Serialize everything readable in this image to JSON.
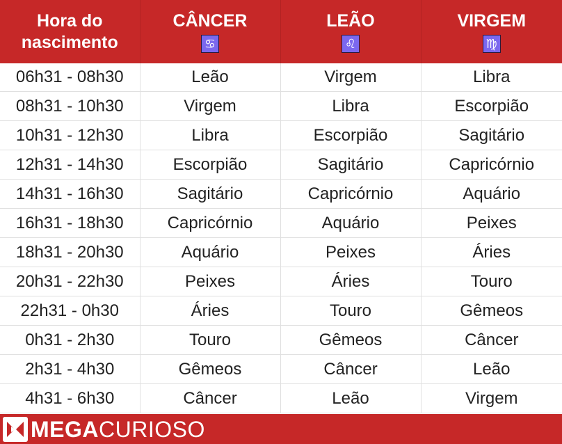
{
  "header": {
    "col0": "Hora do nascimento",
    "signs": [
      {
        "name": "CÂNCER",
        "icon": "cancer-icon",
        "glyph": "♋"
      },
      {
        "name": "LEÃO",
        "icon": "leo-icon",
        "glyph": "♌"
      },
      {
        "name": "VIRGEM",
        "icon": "virgo-icon",
        "glyph": "♍"
      }
    ]
  },
  "rows": [
    {
      "time": "06h31 - 08h30",
      "cancer": "Leão",
      "leao": "Virgem",
      "virgem": "Libra"
    },
    {
      "time": "08h31 - 10h30",
      "cancer": "Virgem",
      "leao": "Libra",
      "virgem": "Escorpião"
    },
    {
      "time": "10h31 - 12h30",
      "cancer": "Libra",
      "leao": "Escorpião",
      "virgem": "Sagitário"
    },
    {
      "time": "12h31 - 14h30",
      "cancer": "Escorpião",
      "leao": "Sagitário",
      "virgem": "Capricórnio"
    },
    {
      "time": "14h31 - 16h30",
      "cancer": "Sagitário",
      "leao": "Capricórnio",
      "virgem": "Aquário"
    },
    {
      "time": "16h31 - 18h30",
      "cancer": "Capricórnio",
      "leao": "Aquário",
      "virgem": "Peixes"
    },
    {
      "time": "18h31 - 20h30",
      "cancer": "Aquário",
      "leao": "Peixes",
      "virgem": "Áries"
    },
    {
      "time": "20h31 - 22h30",
      "cancer": "Peixes",
      "leao": "Áries",
      "virgem": "Touro"
    },
    {
      "time": "22h31 - 0h30",
      "cancer": "Áries",
      "leao": "Touro",
      "virgem": "Gêmeos"
    },
    {
      "time": "0h31 - 2h30",
      "cancer": "Touro",
      "leao": "Gêmeos",
      "virgem": "Câncer"
    },
    {
      "time": "2h31 - 4h30",
      "cancer": "Gêmeos",
      "leao": "Câncer",
      "virgem": "Leão"
    },
    {
      "time": "4h31 - 6h30",
      "cancer": "Câncer",
      "leao": "Leão",
      "virgem": "Virgem"
    }
  ],
  "footer": {
    "brand_bold": "MEGA",
    "brand_light": "CURIOSO",
    "logo_icon": "megacurioso-logo-icon"
  },
  "colors": {
    "header_bg": "#c62828",
    "sign_icon_bg": "#7b68ee",
    "grid": "#e0e0e0"
  }
}
